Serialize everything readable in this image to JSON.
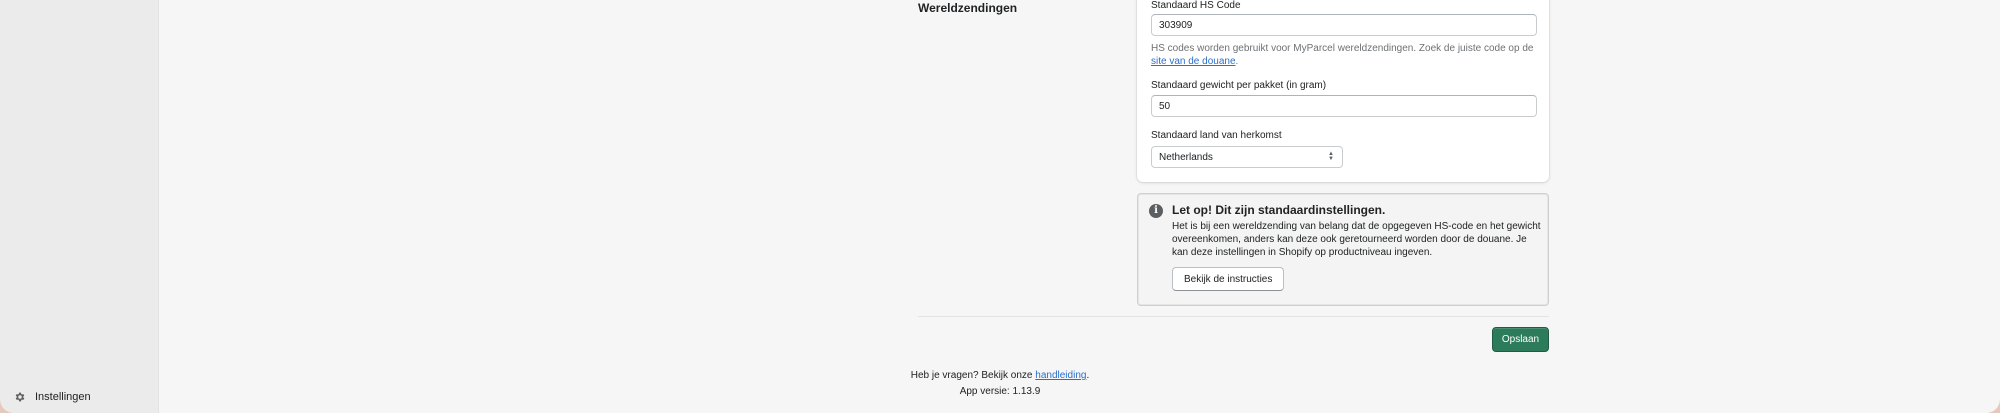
{
  "sidebar": {
    "settings_label": "Instellingen",
    "settings_icon": "gear-icon"
  },
  "section": {
    "title": "Wereldzendingen"
  },
  "form": {
    "hs_code_label": "Standaard HS Code",
    "hs_code_value": "303909",
    "help_text_before": "HS codes worden gebruikt voor MyParcel wereldzendingen. Zoek de juiste code op de ",
    "help_link": "site van de douane",
    "help_text_after": ".",
    "weight_label": "Standaard gewicht per pakket (in gram)",
    "weight_value": "50",
    "country_label": "Standaard land van herkomst",
    "country_value": "Netherlands"
  },
  "banner": {
    "icon": "info-icon",
    "title": "Let op! Dit zijn standaardinstellingen.",
    "text": "Het is bij een wereldzending van belang dat de opgegeven HS-code en het gewicht overeenkomen, anders kan deze ook geretourneerd worden door de douane. Je kan deze instellingen in Shopify op productniveau ingeven.",
    "button_label": "Bekijk de instructies"
  },
  "actions": {
    "save_label": "Opslaan",
    "save_color": "#2c7b5a"
  },
  "footer": {
    "question_before": "Heb je vragen? Bekijk onze ",
    "question_link": "handleiding",
    "question_after": ".",
    "version_text": "App versie: 1.13.9"
  }
}
